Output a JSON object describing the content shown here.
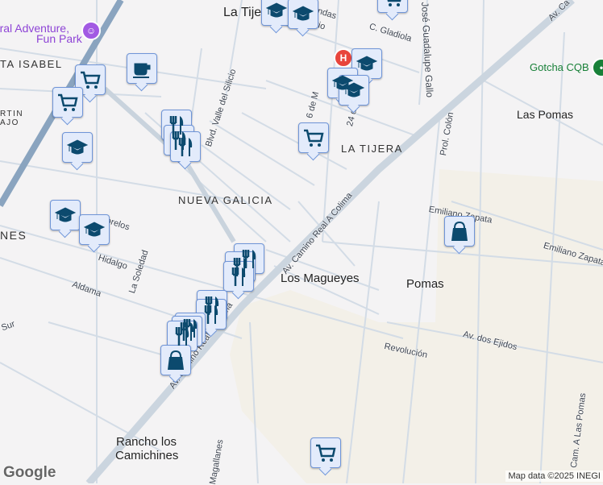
{
  "labels": {
    "la_tijera_top": "La Tijera",
    "fun_park": "Natural Adventure,",
    "fun_park2": "Fun Park",
    "santa_isabel": "TA ISABEL",
    "martin": "RTIN",
    "martin2": "AJO",
    "valle_silicio": "Blvd. Valle del Silicio",
    "gladiola": "C. Gladiola",
    "jose_gallo": "José Guadalupe Gallo",
    "av_ca": "Av. Ca",
    "gotcha": "Gotcha CQB",
    "las_pomas": "Las Pomas",
    "la_tijera": "LA TIJERA",
    "prol_colon": "Prol. Colón",
    "seis_de": "6 de M",
    "veinticuatro": "24 de",
    "nueva_galicia": "NUEVA GALICIA",
    "nes": "NES",
    "morelos": "Morelos",
    "hidalgo": "Hidalgo",
    "la_soledad": "La Soledad",
    "aldama": "Aldama",
    "camino_real": "Av. Camino Real A Colima",
    "camino_real2": "Av. Camino Real A Colima",
    "los_magueyes": "Los Magueyes",
    "pomas": "Pomas",
    "emiliano1": "Emiliano Zapata",
    "emiliano2": "Emiliano Zapata",
    "av_ejidos": "Av. dos Ejidos",
    "revolucion": "Revolución",
    "rancho": "Rancho los",
    "rancho2": "Camichines",
    "cam_pomas": "Cam. A Las Pomas",
    "magallanes": "Magallanes",
    "sur": "Sur",
    "andas": "andas",
    "lirio": "Lirio"
  },
  "markers": [
    {
      "type": "education"
    },
    {
      "type": "education"
    },
    {
      "type": "shopping"
    },
    {
      "type": "education"
    },
    {
      "type": "education"
    },
    {
      "type": "education"
    },
    {
      "type": "shopping"
    },
    {
      "type": "cafe"
    },
    {
      "type": "shopping"
    },
    {
      "type": "shopping"
    },
    {
      "type": "restaurant"
    },
    {
      "type": "restaurant"
    },
    {
      "type": "restaurant"
    },
    {
      "type": "education"
    },
    {
      "type": "education"
    },
    {
      "type": "education"
    },
    {
      "type": "restaurant"
    },
    {
      "type": "restaurant"
    },
    {
      "type": "restaurant"
    },
    {
      "type": "restaurant"
    },
    {
      "type": "restaurant"
    },
    {
      "type": "restaurant"
    },
    {
      "type": "restaurant"
    },
    {
      "type": "restaurant"
    },
    {
      "type": "bag"
    },
    {
      "type": "bag"
    },
    {
      "type": "shopping"
    }
  ],
  "poi": {
    "hospital": "H"
  },
  "footer": {
    "logo": "Google",
    "attribution": "Map data ©2025 INEGI"
  },
  "colors": {
    "road": "#d3dce6",
    "major": "#c9d3dd",
    "highway": "#8aa4bf",
    "beige": "#f3f0e8",
    "marker": "#0c4a6e"
  }
}
